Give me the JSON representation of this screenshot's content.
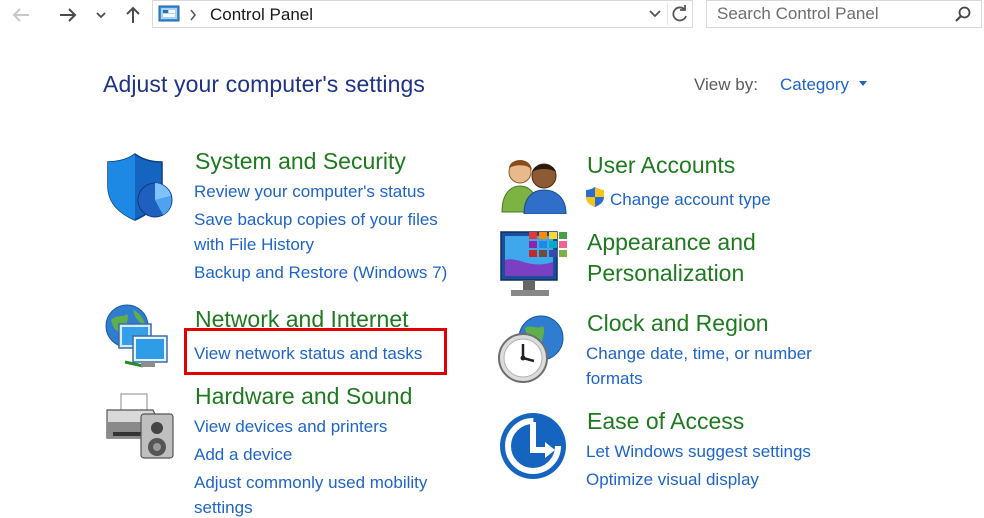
{
  "address": {
    "path": "Control Panel"
  },
  "search": {
    "placeholder": "Search Control Panel"
  },
  "header": {
    "title": "Adjust your computer's settings",
    "view_by_label": "View by:",
    "view_by_value": "Category"
  },
  "categories": {
    "system_security": {
      "title": "System and Security",
      "links": [
        "Review your computer's status",
        "Save backup copies of your files",
        "with File History",
        "Backup and Restore (Windows 7)"
      ]
    },
    "network": {
      "title": "Network and Internet",
      "links": [
        "View network status and tasks"
      ]
    },
    "hardware": {
      "title": "Hardware and Sound",
      "links": [
        "View devices and printers",
        "Add a device",
        "Adjust commonly used mobility",
        "settings"
      ]
    },
    "user_accounts": {
      "title": "User Accounts",
      "links": [
        "Change account type"
      ]
    },
    "appearance": {
      "title_line1": "Appearance and",
      "title_line2": "Personalization"
    },
    "clock": {
      "title": "Clock and Region",
      "links": [
        "Change date, time, or number",
        "formats"
      ]
    },
    "ease": {
      "title": "Ease of Access",
      "links": [
        "Let Windows suggest settings",
        "Optimize visual display"
      ]
    }
  },
  "colors": {
    "title_blue": "#1e3287",
    "link_blue": "#1e64c8",
    "category_green": "#1e7a1e",
    "highlight_red": "#e00000"
  },
  "icons": {
    "back": "arrow-left-icon",
    "forward": "arrow-right-icon",
    "recent": "chevron-down-icon",
    "up": "arrow-up-icon",
    "refresh": "refresh-icon",
    "search": "search-icon"
  }
}
